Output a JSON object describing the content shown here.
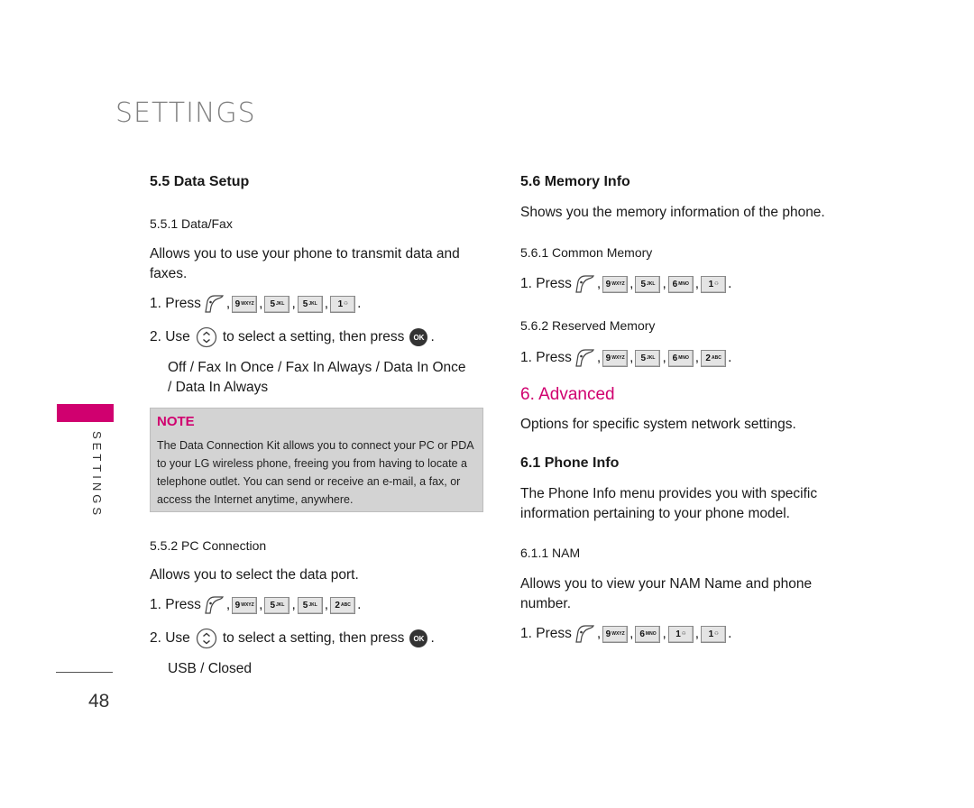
{
  "page": {
    "section_title": "SETTINGS",
    "side_label": "SETTINGS",
    "page_number": "48",
    "accent_color": "#d0006f"
  },
  "left": {
    "data_setup": {
      "heading": "5.5 Data Setup",
      "data_fax": {
        "heading": "5.5.1 Data/Fax",
        "description": "Allows you to use your phone to transmit data and faxes.",
        "step1_prefix": "1. Press",
        "step1_keys": [
          {
            "icon": "menu-soft-key-icon"
          },
          {
            "main": "9",
            "sub": "WXYZ"
          },
          {
            "main": "5",
            "sub": "JKL"
          },
          {
            "main": "5",
            "sub": "JKL"
          },
          {
            "main": "1",
            "sub": "voicemail"
          }
        ],
        "step2_prefix": "2. Use",
        "step2_middle": "to select a setting, then press",
        "ok_label": "OK",
        "options_line1": "Off / Fax In Once / Fax In Always / Data In Once",
        "options_line2": "/ Data In Always"
      },
      "note": {
        "title": "NOTE",
        "text": "The Data Connection Kit allows you to connect your PC or PDA to your LG wireless phone, freeing you from having to locate a telephone outlet. You can send or receive an e-mail, a fax, or access the Internet anytime, anywhere."
      },
      "pc_connection": {
        "heading": "5.5.2 PC Connection",
        "description": "Allows you to select the data port.",
        "step1_prefix": "1. Press",
        "step1_keys": [
          {
            "icon": "menu-soft-key-icon"
          },
          {
            "main": "9",
            "sub": "WXYZ"
          },
          {
            "main": "5",
            "sub": "JKL"
          },
          {
            "main": "5",
            "sub": "JKL"
          },
          {
            "main": "2",
            "sub": "ABC"
          }
        ],
        "step2_prefix": "2. Use",
        "step2_middle": "to select a setting, then press",
        "ok_label": "OK",
        "options": "USB / Closed"
      }
    }
  },
  "right": {
    "memory_info": {
      "heading": "5.6 Memory Info",
      "description": "Shows you the memory information of the phone.",
      "common": {
        "heading": "5.6.1 Common Memory",
        "step1_prefix": "1. Press",
        "keys": [
          {
            "main": "9",
            "sub": "WXYZ"
          },
          {
            "main": "5",
            "sub": "JKL"
          },
          {
            "main": "6",
            "sub": "MNO"
          },
          {
            "main": "1",
            "sub": "voicemail"
          }
        ]
      },
      "reserved": {
        "heading": "5.6.2 Reserved Memory",
        "step1_prefix": "1. Press",
        "keys": [
          {
            "main": "9",
            "sub": "WXYZ"
          },
          {
            "main": "5",
            "sub": "JKL"
          },
          {
            "main": "6",
            "sub": "MNO"
          },
          {
            "main": "2",
            "sub": "ABC"
          }
        ]
      }
    },
    "advanced": {
      "heading": "6. Advanced",
      "description": "Options for specific system network settings.",
      "phone_info": {
        "heading": "6.1 Phone Info",
        "description": "The Phone Info menu provides you with specific information pertaining to your phone model.",
        "nam": {
          "heading": "6.1.1 NAM",
          "description": "Allows you to view your NAM Name and phone number.",
          "step1_prefix": "1. Press",
          "keys": [
            {
              "main": "9",
              "sub": "WXYZ"
            },
            {
              "main": "6",
              "sub": "MNO"
            },
            {
              "main": "1",
              "sub": "voicemail"
            },
            {
              "main": "1",
              "sub": "voicemail"
            }
          ]
        }
      }
    }
  },
  "symbols": {
    "comma": ",",
    "period": "."
  }
}
